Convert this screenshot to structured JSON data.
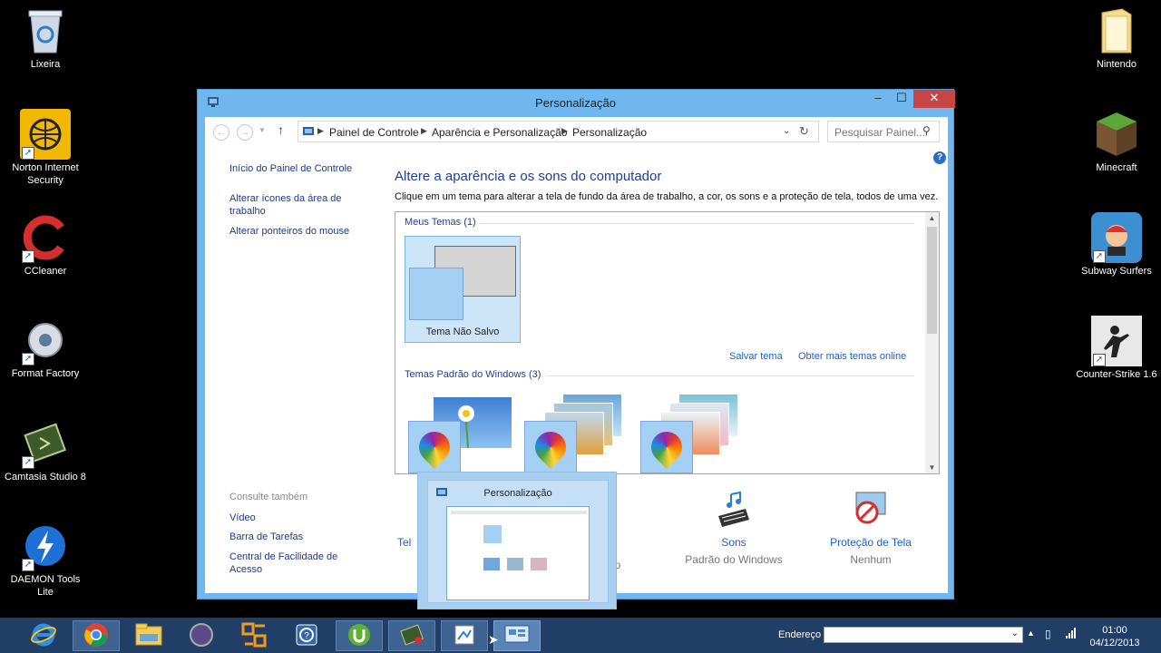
{
  "desktop": {
    "left_icons": [
      {
        "label": "Lixeira",
        "icon": "recycle-bin-icon"
      },
      {
        "label": "Norton Internet Security",
        "icon": "norton-icon"
      },
      {
        "label": "CCleaner",
        "icon": "ccleaner-icon"
      },
      {
        "label": "Format Factory",
        "icon": "format-factory-icon"
      },
      {
        "label": "Camtasia Studio 8",
        "icon": "camtasia-icon"
      },
      {
        "label": "DAEMON Tools Lite",
        "icon": "daemon-tools-icon"
      }
    ],
    "right_icons": [
      {
        "label": "Nintendo",
        "icon": "folder-icon"
      },
      {
        "label": "Minecraft",
        "icon": "minecraft-icon"
      },
      {
        "label": "Subway Surfers",
        "icon": "subway-surfers-icon"
      },
      {
        "label": "Counter-Strike 1.6",
        "icon": "counter-strike-icon"
      }
    ]
  },
  "window": {
    "title": "Personalização",
    "controls": {
      "minimize": "–",
      "maximize": "☐",
      "close": "✕"
    },
    "breadcrumb": [
      "Painel de Controle",
      "Aparência e Personalização",
      "Personalização"
    ],
    "search_placeholder": "Pesquisar Painel...",
    "help": "?"
  },
  "sidebar": {
    "links": [
      "Início do Painel de Controle",
      "Alterar ícones da área de trabalho",
      "Alterar ponteiros do mouse"
    ],
    "see_also_label": "Consulte também",
    "see_also": [
      "Vídeo",
      "Barra de Tarefas",
      "Central de Facilidade de Acesso"
    ]
  },
  "main": {
    "title": "Altere a aparência e os sons do computador",
    "subtitle": "Clique em um tema para alterar a tela de fundo da área de trabalho, a cor, os sons e a proteção de tela, todos de uma vez.",
    "my_themes_label": "Meus Temas (1)",
    "unsaved_theme": "Tema Não Salvo",
    "save_theme": "Salvar tema",
    "get_more_themes": "Obter mais temas online",
    "windows_themes_label": "Temas Padrão do Windows (3)"
  },
  "bottom": {
    "background_partial": "Tel",
    "color_partial": "do",
    "sounds": {
      "label": "Sons",
      "value": "Padrão do Windows"
    },
    "screensaver": {
      "label": "Proteção de Tela",
      "value": "Nenhum"
    }
  },
  "thumbnail": {
    "title": "Personalização"
  },
  "taskbar": {
    "apps": [
      "internet-explorer-icon",
      "chrome-icon",
      "file-explorer-icon",
      "media-player-icon",
      "format-factory-icon",
      "help-icon",
      "utorrent-icon",
      "camtasia-icon",
      "paint-icon",
      "control-panel-icon"
    ],
    "address_label": "Endereço",
    "time": "01:00",
    "date": "04/12/2013"
  }
}
